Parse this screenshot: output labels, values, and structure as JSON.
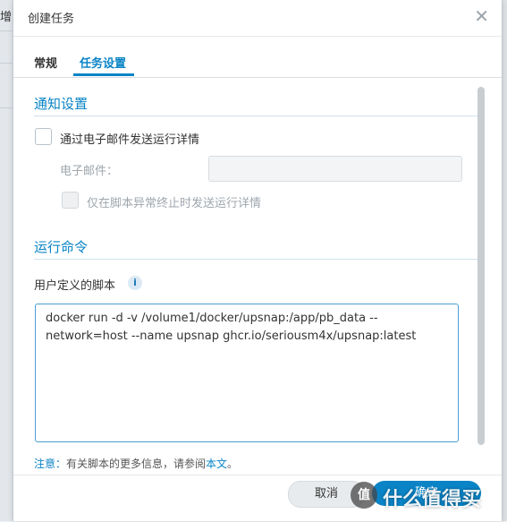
{
  "background": {
    "partial_text": "增"
  },
  "dialog": {
    "title": "创建任务",
    "close_glyph": "✕"
  },
  "tabs": [
    {
      "label": "常规",
      "active": false
    },
    {
      "label": "任务设置",
      "active": true
    }
  ],
  "notification": {
    "section_title": "通知设置",
    "send_email_label": "通过电子邮件发送运行详情",
    "send_email_checked": false,
    "email_label": "电子邮件：",
    "email_value": "",
    "only_on_error_label": "仅在脚本异常终止时发送运行详情",
    "only_on_error_checked": false
  },
  "run_command": {
    "section_title": "运行命令",
    "script_label": "用户定义的脚本",
    "info_glyph": "i",
    "script_value": "docker run -d -v /volume1/docker/upsnap:/app/pb_data --network=host --name upsnap ghcr.io/seriousm4x/upsnap:latest"
  },
  "note": {
    "prefix": "注意：",
    "text": "有关脚本的更多信息，请参阅",
    "link": "本文",
    "suffix": "。"
  },
  "footer": {
    "cancel_label": "取消",
    "ok_label": "确定"
  },
  "watermark": {
    "badge": "值",
    "text": "什么值得买"
  },
  "colors": {
    "accent": "#0a84c6",
    "text": "#333333",
    "disabled_text": "#9ea6ad"
  }
}
